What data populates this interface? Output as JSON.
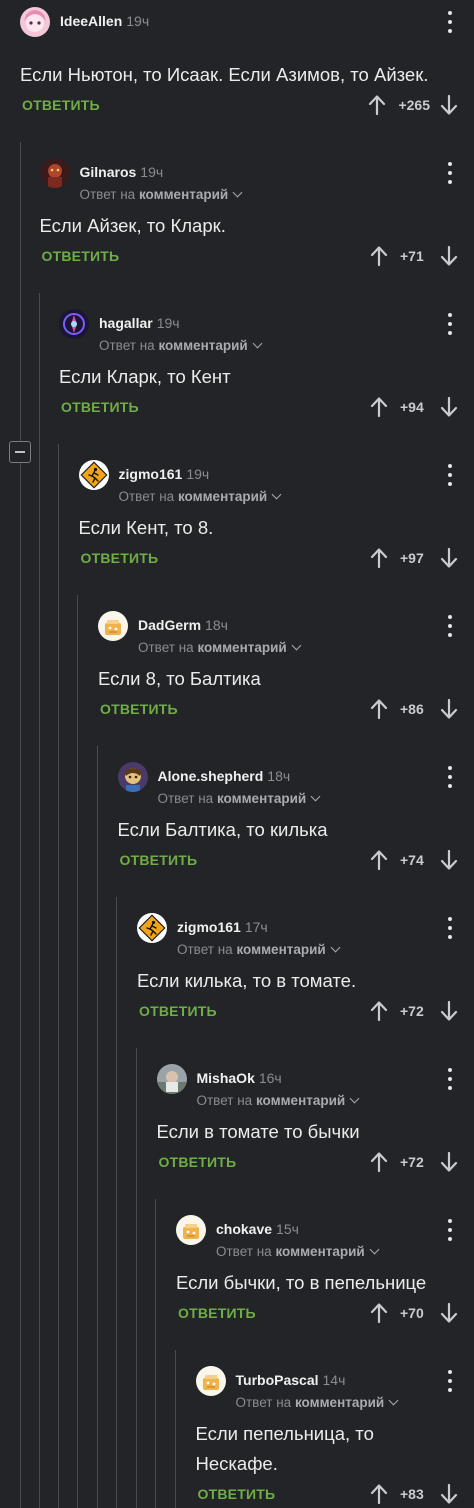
{
  "common": {
    "reply_label": "ОТВЕТИТЬ",
    "reply_to_prefix": "Ответ на",
    "reply_to_link": "комментарий"
  },
  "comments": [
    {
      "author": "IdeeAllen",
      "time": "19ч",
      "text": "Если Ньютон, то Исаак. Если Азимов, то Айзек.",
      "votes": "+265",
      "avatar": "anime-avatar",
      "reply_to": false
    },
    {
      "author": "Gilnaros",
      "time": "19ч",
      "text": "Если Айзек, то Кларк.",
      "votes": "+71",
      "avatar": "dark-red-avatar",
      "reply_to": true
    },
    {
      "author": "hagallar",
      "time": "19ч",
      "text": "Если Кларк, то Кент",
      "votes": "+94",
      "avatar": "purple-emblem-avatar",
      "reply_to": true
    },
    {
      "author": "zigmo161",
      "time": "19ч",
      "text": "Если Кент, то 8.",
      "votes": "+97",
      "avatar": "runner-sign-avatar",
      "reply_to": true
    },
    {
      "author": "DadGerm",
      "time": "18ч",
      "text": "Если 8, то Балтика",
      "votes": "+86",
      "avatar": "default-avatar",
      "reply_to": true
    },
    {
      "author": "Alone.shepherd",
      "time": "18ч",
      "text": "Если Балтика, то килька",
      "votes": "+74",
      "avatar": "character-avatar",
      "reply_to": true
    },
    {
      "author": "zigmo161",
      "time": "17ч",
      "text": "Если килька, то в томате.",
      "votes": "+72",
      "avatar": "runner-sign-avatar",
      "reply_to": true
    },
    {
      "author": "MishaOk",
      "time": "16ч",
      "text": "Если в томате то бычки",
      "votes": "+72",
      "avatar": "photo-avatar",
      "reply_to": true
    },
    {
      "author": "chokave",
      "time": "15ч",
      "text": "Если бычки, то в пепельнице",
      "votes": "+70",
      "avatar": "default-avatar",
      "reply_to": true
    },
    {
      "author": "TurboPascal",
      "time": "14ч",
      "text": "Если пепельница, то Нескафе.",
      "votes": "+83",
      "avatar": "default-avatar",
      "reply_to": true
    }
  ]
}
